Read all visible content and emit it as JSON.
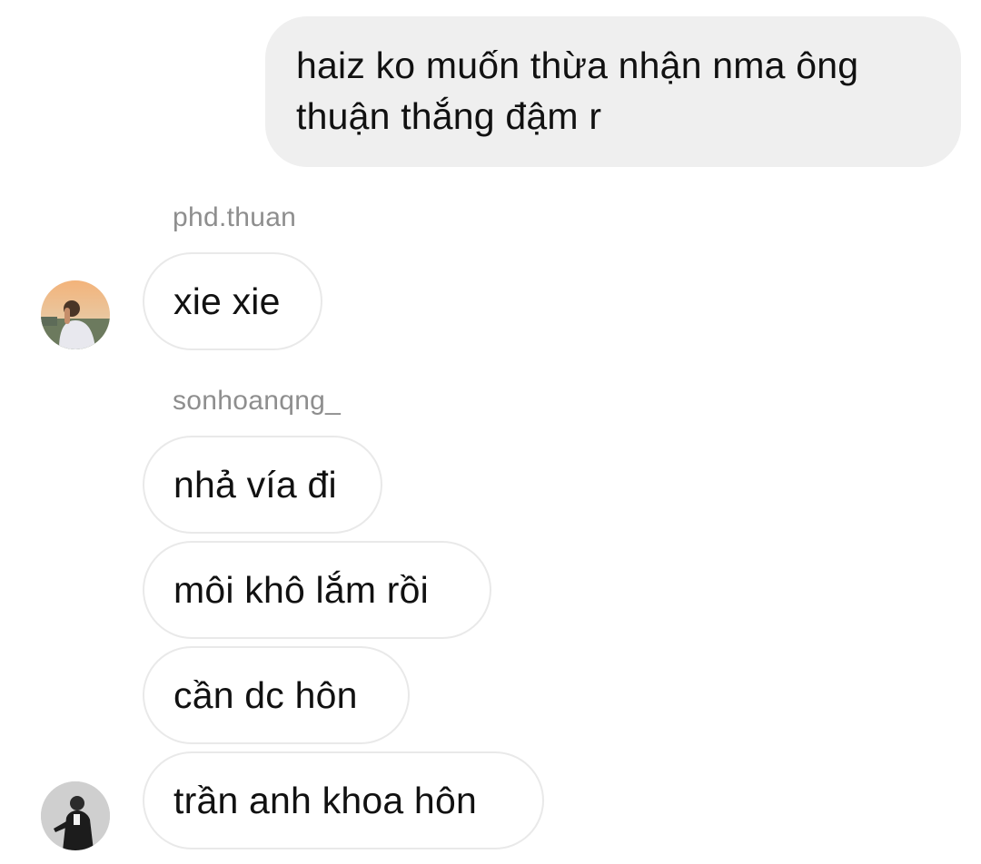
{
  "messages": {
    "outgoing_1": {
      "line1": "haiz ko muốn thừa nhận nma ông",
      "line2": "thuận thắng đậm r"
    },
    "group_1": {
      "sender": "phd.thuan",
      "messages": [
        "xie xie"
      ],
      "avatar_icon": "profile-photo-sunset-avatar"
    },
    "group_2": {
      "sender": "sonhoanqng_",
      "messages": [
        "nhả vía đi",
        "môi khô lắm rồi",
        "cần dc hôn",
        "trần anh khoa hôn"
      ],
      "avatar_icon": "profile-photo-bw-avatar"
    }
  },
  "colors": {
    "outgoing_bubble": "#efefef",
    "incoming_border": "#e9e9e9",
    "sender_label": "#8e8e8e",
    "text": "#111111"
  }
}
